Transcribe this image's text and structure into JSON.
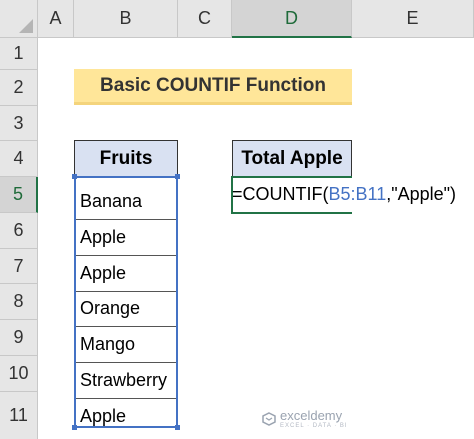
{
  "columns": [
    "A",
    "B",
    "C",
    "D",
    "E"
  ],
  "rows": [
    "1",
    "2",
    "3",
    "4",
    "5",
    "6",
    "7",
    "8",
    "9",
    "10",
    "11"
  ],
  "selected_column": "D",
  "selected_row": "5",
  "title": "Basic COUNTIF Function",
  "fruits_header": "Fruits",
  "total_header": "Total Apple",
  "fruits": [
    "Banana",
    "Apple",
    "Apple",
    "Orange",
    "Mango",
    "Strawberry",
    "Apple"
  ],
  "formula": {
    "prefix": "=COUNTIF(",
    "range": "B5:B11",
    "suffix": ",\"Apple\")"
  },
  "watermark": {
    "name": "exceldemy",
    "tagline": "EXCEL · DATA · BI"
  },
  "colors": {
    "title_fill": "#ffe699",
    "header_fill": "#d9e1f2",
    "range_highlight": "#4472c4",
    "selection": "#217346"
  }
}
